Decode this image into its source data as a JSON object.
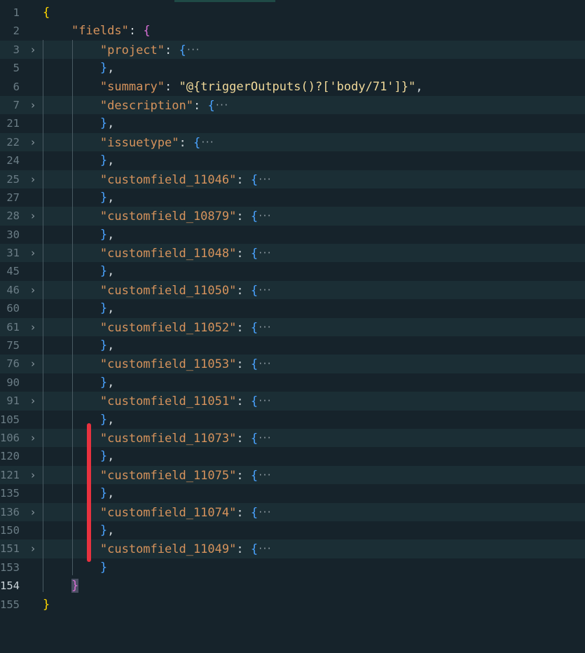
{
  "editor": {
    "lines": [
      {
        "num": "1",
        "indent": "",
        "open": "{",
        "kind": "root-open"
      },
      {
        "num": "2",
        "indent": "    ",
        "key": "\"fields\"",
        "sep": ": ",
        "open": "{",
        "kind": "fields-open"
      },
      {
        "num": "3",
        "indent": "        ",
        "key": "\"project\"",
        "sep": ": ",
        "open": "{",
        "ellipsis": "···",
        "kind": "folded",
        "fold": true
      },
      {
        "num": "5",
        "indent": "        ",
        "close": "}",
        "tail": ",",
        "kind": "close"
      },
      {
        "num": "6",
        "indent": "        ",
        "key": "\"summary\"",
        "sep": ": ",
        "value": "\"@{triggerOutputs()?['body/71']}\"",
        "tail": ",",
        "kind": "string"
      },
      {
        "num": "7",
        "indent": "        ",
        "key": "\"description\"",
        "sep": ": ",
        "open": "{",
        "ellipsis": "···",
        "kind": "folded",
        "fold": true
      },
      {
        "num": "21",
        "indent": "        ",
        "close": "}",
        "tail": ",",
        "kind": "close"
      },
      {
        "num": "22",
        "indent": "        ",
        "key": "\"issuetype\"",
        "sep": ": ",
        "open": "{",
        "ellipsis": "···",
        "kind": "folded",
        "fold": true
      },
      {
        "num": "24",
        "indent": "        ",
        "close": "}",
        "tail": ",",
        "kind": "close"
      },
      {
        "num": "25",
        "indent": "        ",
        "key": "\"customfield_11046\"",
        "sep": ": ",
        "open": "{",
        "ellipsis": "···",
        "kind": "folded",
        "fold": true
      },
      {
        "num": "27",
        "indent": "        ",
        "close": "}",
        "tail": ",",
        "kind": "close"
      },
      {
        "num": "28",
        "indent": "        ",
        "key": "\"customfield_10879\"",
        "sep": ": ",
        "open": "{",
        "ellipsis": "···",
        "kind": "folded",
        "fold": true
      },
      {
        "num": "30",
        "indent": "        ",
        "close": "}",
        "tail": ",",
        "kind": "close"
      },
      {
        "num": "31",
        "indent": "        ",
        "key": "\"customfield_11048\"",
        "sep": ": ",
        "open": "{",
        "ellipsis": "···",
        "kind": "folded",
        "fold": true
      },
      {
        "num": "45",
        "indent": "        ",
        "close": "}",
        "tail": ",",
        "kind": "close"
      },
      {
        "num": "46",
        "indent": "        ",
        "key": "\"customfield_11050\"",
        "sep": ": ",
        "open": "{",
        "ellipsis": "···",
        "kind": "folded",
        "fold": true
      },
      {
        "num": "60",
        "indent": "        ",
        "close": "}",
        "tail": ",",
        "kind": "close"
      },
      {
        "num": "61",
        "indent": "        ",
        "key": "\"customfield_11052\"",
        "sep": ": ",
        "open": "{",
        "ellipsis": "···",
        "kind": "folded",
        "fold": true
      },
      {
        "num": "75",
        "indent": "        ",
        "close": "}",
        "tail": ",",
        "kind": "close"
      },
      {
        "num": "76",
        "indent": "        ",
        "key": "\"customfield_11053\"",
        "sep": ": ",
        "open": "{",
        "ellipsis": "···",
        "kind": "folded",
        "fold": true
      },
      {
        "num": "90",
        "indent": "        ",
        "close": "}",
        "tail": ",",
        "kind": "close"
      },
      {
        "num": "91",
        "indent": "        ",
        "key": "\"customfield_11051\"",
        "sep": ": ",
        "open": "{",
        "ellipsis": "···",
        "kind": "folded",
        "fold": true
      },
      {
        "num": "105",
        "indent": "        ",
        "close": "}",
        "tail": ",",
        "kind": "close"
      },
      {
        "num": "106",
        "indent": "        ",
        "key": "\"customfield_11073\"",
        "sep": ": ",
        "open": "{",
        "ellipsis": "···",
        "kind": "folded",
        "fold": true
      },
      {
        "num": "120",
        "indent": "        ",
        "close": "}",
        "tail": ",",
        "kind": "close"
      },
      {
        "num": "121",
        "indent": "        ",
        "key": "\"customfield_11075\"",
        "sep": ": ",
        "open": "{",
        "ellipsis": "···",
        "kind": "folded",
        "fold": true
      },
      {
        "num": "135",
        "indent": "        ",
        "close": "}",
        "tail": ",",
        "kind": "close"
      },
      {
        "num": "136",
        "indent": "        ",
        "key": "\"customfield_11074\"",
        "sep": ": ",
        "open": "{",
        "ellipsis": "···",
        "kind": "folded",
        "fold": true
      },
      {
        "num": "150",
        "indent": "        ",
        "close": "}",
        "tail": ",",
        "kind": "close"
      },
      {
        "num": "151",
        "indent": "        ",
        "key": "\"customfield_11049\"",
        "sep": ": ",
        "open": "{",
        "ellipsis": "···",
        "kind": "folded",
        "fold": true
      },
      {
        "num": "153",
        "indent": "        ",
        "close": "}",
        "tail": "",
        "kind": "close"
      },
      {
        "num": "154",
        "indent": "    ",
        "close": "}",
        "tail": "",
        "kind": "fields-close",
        "current": true
      },
      {
        "num": "155",
        "indent": "",
        "close": "}",
        "tail": "",
        "kind": "root-close"
      }
    ]
  },
  "colors": {
    "background": "#16232b",
    "folded_line_bg": "#1b2e35",
    "key": "#d6935c",
    "string": "#f0d99a",
    "bracket_level1": "#ffd700",
    "bracket_level2": "#da70d6",
    "bracket_level3": "#4aa3ff",
    "annotation_mark": "#e8323f"
  },
  "icons": {
    "fold": "chevron-right-icon"
  }
}
